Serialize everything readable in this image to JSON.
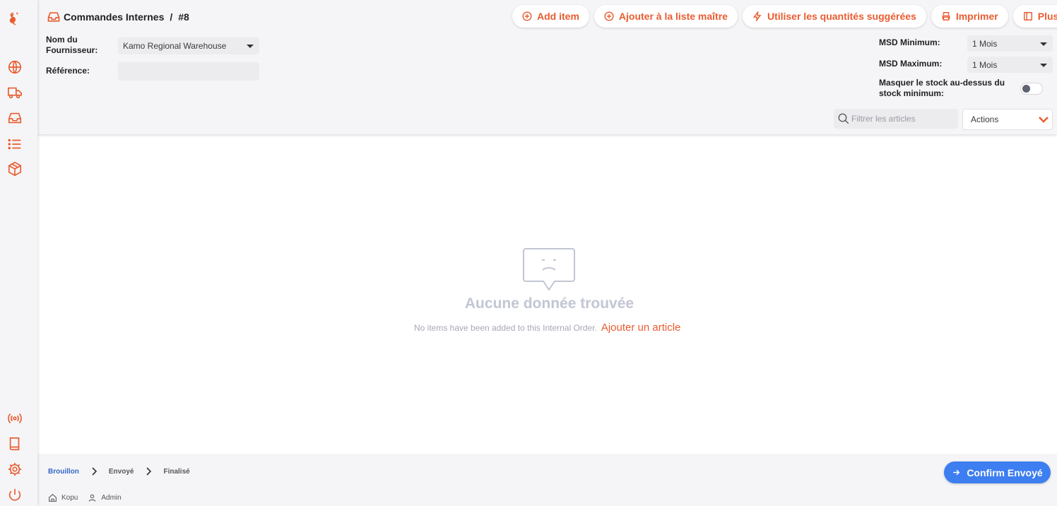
{
  "brand": {
    "accent": "#e95c30",
    "primary_blue": "#3d7ef1"
  },
  "sidebar": {
    "logo_icon": "kangaroo-logo-icon",
    "top_items": [
      "globe-icon",
      "truck-icon",
      "inbox-icon",
      "list-icon",
      "box-icon"
    ],
    "bottom_items": [
      "broadcast-icon",
      "book-icon",
      "gear-icon",
      "power-icon"
    ]
  },
  "header": {
    "breadcrumb": {
      "section": "Commandes Internes",
      "separator": "/",
      "id": "#8"
    },
    "toolbar": {
      "add_item": "Add item",
      "add_master_list": "Ajouter à la liste maître",
      "suggested_quantities": "Utiliser les quantités suggérées",
      "print": "Imprimer",
      "more": "Plus"
    },
    "supplier": {
      "label_line1": "Nom du",
      "label_line2": "Fournisseur:",
      "value": "Kamo Regional Warehouse"
    },
    "reference": {
      "label": "Référence:",
      "value": ""
    },
    "msd_min": {
      "label": "MSD Minimum:",
      "value": "1 Mois"
    },
    "msd_max": {
      "label": "MSD Maximum:",
      "value": "1 Mois"
    },
    "hide_stock": {
      "label_line1": "Masquer le stock au-dessus du",
      "label_line2": "stock minimum:",
      "enabled": false
    },
    "filter": {
      "placeholder": "Filtrer les articles",
      "value": ""
    },
    "actions": {
      "label": "Actions"
    }
  },
  "empty_state": {
    "title": "Aucune donnée trouvée",
    "message": "No items have been added to this Internal Order.",
    "link": "Ajouter un article"
  },
  "footer": {
    "steps": [
      "Brouillon",
      "Envoyé",
      "Finalisé"
    ],
    "active_step": "Brouillon",
    "store": "Kopu",
    "user": "Admin",
    "confirm_button": "Confirm Envoyé"
  }
}
